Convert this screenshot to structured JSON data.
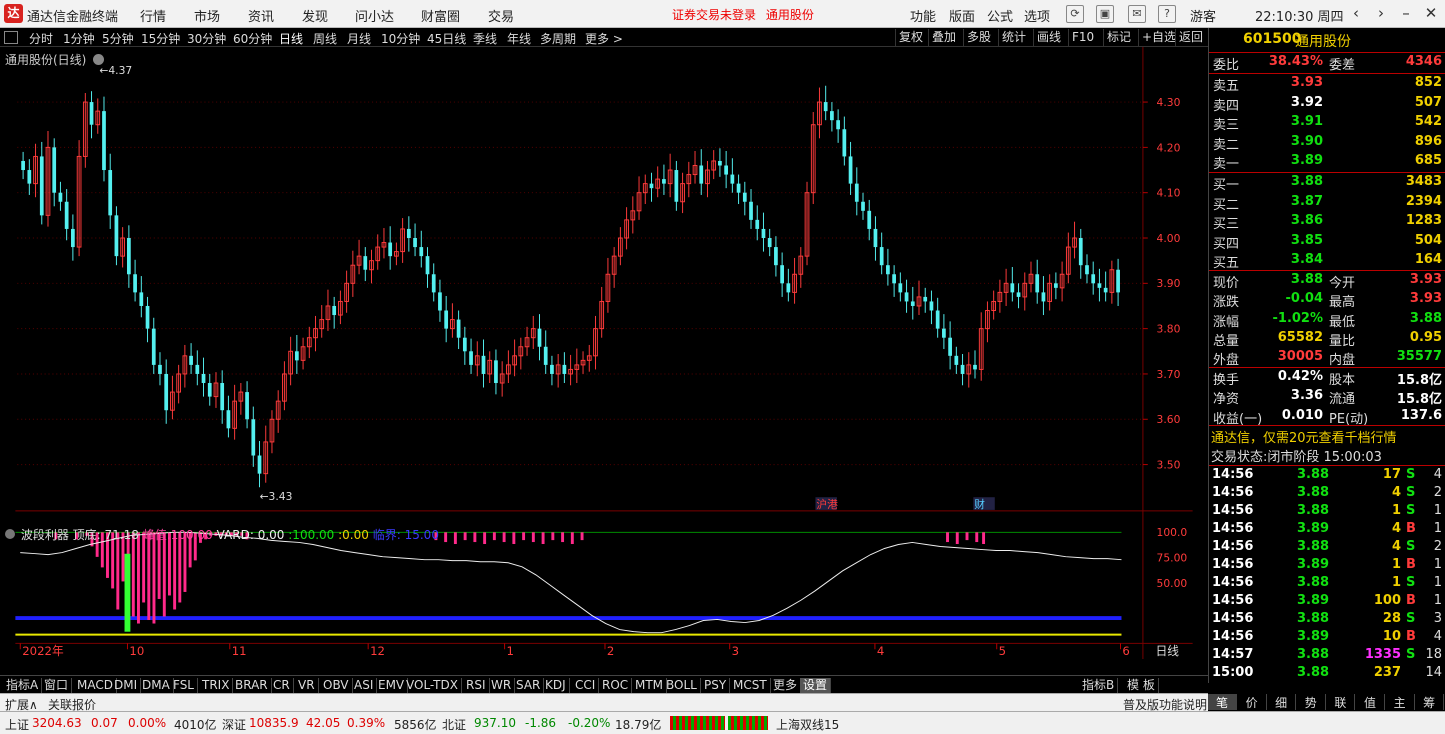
{
  "titlebar": {
    "logo": "达",
    "app_title": "通达信金融终端",
    "menu": [
      "行情",
      "市场",
      "资讯",
      "发现",
      "问小达",
      "财富圈",
      "交易"
    ],
    "notice_left": "证券交易未登录",
    "notice_right": "通用股份",
    "right_menu": [
      "功能",
      "版面",
      "公式",
      "选项"
    ],
    "user": "游客",
    "clock": "22:10:30 周四"
  },
  "period_bar": {
    "items": [
      "分时",
      "1分钟",
      "5分钟",
      "15分钟",
      "30分钟",
      "60分钟",
      "日线",
      "周线",
      "月线",
      "10分钟",
      "45日线",
      "季线",
      "年线",
      "多周期",
      "更多 >"
    ],
    "active": "日线",
    "tools": [
      "复权",
      "叠加",
      "多股",
      "统计",
      "画线",
      "F10",
      "标记",
      "+自选",
      "返回"
    ]
  },
  "chart": {
    "title": "通用股份(日线)",
    "high_label": "4.37",
    "low_label": "3.43",
    "event_marks": [
      "沪港",
      "财"
    ],
    "date_labels": [
      "2022年",
      "10",
      "11",
      "12",
      "1",
      "2",
      "3",
      "4",
      "5",
      "6"
    ],
    "period_tag": "日线",
    "indicator": {
      "name": "波段利器",
      "ding_di_label": "顶底:",
      "ding_di_value": "71.18",
      "peak_label": "峰值:",
      "peak_value": "100.00",
      "vard_label": "VARD:",
      "vard_value": "0.00",
      "sep1": ":100.00",
      "sep2": ":0.00",
      "limit_label": "临界:",
      "limit_value": "15.00"
    },
    "chart_data": {
      "type": "candlestick",
      "price_axis": [
        "4.30",
        "4.20",
        "4.10",
        "4.00",
        "3.90",
        "3.80",
        "3.70",
        "3.60",
        "3.50"
      ],
      "ylim": [
        3.4,
        4.4
      ],
      "indicator_axis": [
        "100.0",
        "75.00",
        "50.00"
      ],
      "indicator_ylim": [
        0,
        100
      ],
      "close": [
        4.15,
        4.12,
        4.18,
        4.05,
        4.2,
        4.1,
        4.08,
        4.02,
        3.98,
        4.18,
        4.3,
        4.25,
        4.28,
        4.15,
        4.05,
        3.96,
        4.0,
        3.92,
        3.88,
        3.85,
        3.8,
        3.72,
        3.7,
        3.62,
        3.66,
        3.7,
        3.74,
        3.72,
        3.7,
        3.68,
        3.65,
        3.68,
        3.62,
        3.58,
        3.64,
        3.66,
        3.6,
        3.52,
        3.48,
        3.55,
        3.6,
        3.64,
        3.7,
        3.75,
        3.73,
        3.76,
        3.78,
        3.8,
        3.82,
        3.85,
        3.83,
        3.86,
        3.9,
        3.94,
        3.96,
        3.93,
        3.95,
        3.98,
        3.99,
        3.96,
        3.97,
        4.02,
        4.0,
        3.98,
        3.96,
        3.92,
        3.88,
        3.84,
        3.8,
        3.82,
        3.78,
        3.75,
        3.72,
        3.74,
        3.7,
        3.73,
        3.68,
        3.7,
        3.72,
        3.74,
        3.76,
        3.78,
        3.8,
        3.76,
        3.72,
        3.7,
        3.72,
        3.7,
        3.71,
        3.72,
        3.73,
        3.74,
        3.8,
        3.86,
        3.92,
        3.96,
        4.0,
        4.04,
        4.06,
        4.1,
        4.12,
        4.11,
        4.13,
        4.12,
        4.15,
        4.08,
        4.12,
        4.14,
        4.16,
        4.12,
        4.15,
        4.17,
        4.16,
        4.14,
        4.12,
        4.1,
        4.08,
        4.04,
        4.02,
        4.0,
        3.98,
        3.94,
        3.9,
        3.88,
        3.92,
        3.96,
        4.1,
        4.25,
        4.3,
        4.28,
        4.26,
        4.24,
        4.18,
        4.12,
        4.08,
        4.06,
        4.02,
        3.98,
        3.94,
        3.92,
        3.9,
        3.88,
        3.86,
        3.85,
        3.87,
        3.86,
        3.84,
        3.8,
        3.78,
        3.74,
        3.72,
        3.7,
        3.72,
        3.71,
        3.8,
        3.84,
        3.86,
        3.88,
        3.9,
        3.88,
        3.87,
        3.9,
        3.92,
        3.88,
        3.86,
        3.9,
        3.89,
        3.92,
        3.98,
        4.0,
        3.94,
        3.92,
        3.9,
        3.89,
        3.88,
        3.93,
        3.88
      ],
      "indicator_line": [
        80,
        79,
        78,
        80,
        84,
        88,
        91,
        94,
        97,
        98,
        99,
        100,
        100,
        99,
        98,
        97,
        95,
        94,
        92,
        91,
        90,
        88,
        85,
        82,
        80,
        78,
        76,
        75,
        74,
        73,
        73,
        72,
        72,
        71,
        71,
        70,
        66,
        58,
        48,
        38,
        28,
        18,
        10,
        4,
        2,
        1,
        1,
        4,
        8,
        13,
        14,
        12,
        11,
        13,
        18,
        25,
        33,
        42,
        52,
        62,
        70,
        78,
        84,
        88,
        90,
        88,
        86,
        85,
        84,
        83,
        82,
        82,
        81,
        80,
        78,
        76,
        75,
        74,
        74,
        73
      ],
      "pink_bar_region_1": [
        0,
        1,
        2,
        3,
        4,
        5,
        6,
        7,
        8,
        9,
        10,
        11,
        12,
        13,
        14,
        15,
        16,
        17,
        18,
        19,
        20,
        21,
        22,
        23,
        24,
        25,
        26,
        27,
        28,
        29,
        30,
        31,
        32,
        33,
        34,
        35,
        36,
        37,
        38,
        39,
        40,
        41,
        42,
        43,
        44,
        45,
        46,
        47,
        48,
        49,
        50
      ],
      "bar_depth_1": [
        2,
        0,
        0,
        0,
        2,
        0,
        1,
        4,
        7,
        10,
        13,
        16,
        22,
        14,
        18,
        24,
        26,
        20,
        25,
        26,
        19,
        24,
        18,
        22,
        20,
        17,
        10,
        8,
        3,
        2,
        1,
        1,
        1,
        1,
        1,
        1,
        1,
        2,
        0,
        0,
        0,
        0,
        0,
        0,
        0,
        0,
        0,
        0,
        0,
        0,
        0
      ],
      "green_bar_value": 28
    }
  },
  "quote_panel": {
    "code": "601500",
    "name": "通用股份",
    "wei_bi_label": "委比",
    "wei_bi": "38.43%",
    "wei_cha_label": "委差",
    "wei_cha": "4346",
    "asks": [
      {
        "label": "卖五",
        "price": "3.93",
        "vol": "852"
      },
      {
        "label": "卖四",
        "price": "3.92",
        "vol": "507"
      },
      {
        "label": "卖三",
        "price": "3.91",
        "vol": "542"
      },
      {
        "label": "卖二",
        "price": "3.90",
        "vol": "896"
      },
      {
        "label": "卖一",
        "price": "3.89",
        "vol": "685"
      }
    ],
    "bids": [
      {
        "label": "买一",
        "price": "3.88",
        "vol": "3483"
      },
      {
        "label": "买二",
        "price": "3.87",
        "vol": "2394"
      },
      {
        "label": "买三",
        "price": "3.86",
        "vol": "1283"
      },
      {
        "label": "买四",
        "price": "3.85",
        "vol": "504"
      },
      {
        "label": "买五",
        "price": "3.84",
        "vol": "164"
      }
    ],
    "stats": [
      {
        "l1": "现价",
        "v1": "3.88",
        "c1": "grn",
        "l2": "今开",
        "v2": "3.93",
        "c2": "red"
      },
      {
        "l1": "涨跌",
        "v1": "-0.04",
        "c1": "grn",
        "l2": "最高",
        "v2": "3.93",
        "c2": "red"
      },
      {
        "l1": "涨幅",
        "v1": "-1.02%",
        "c1": "grn",
        "l2": "最低",
        "v2": "3.88",
        "c2": "grn"
      },
      {
        "l1": "总量",
        "v1": "65582",
        "c1": "yel",
        "l2": "量比",
        "v2": "0.95",
        "c2": "yel"
      },
      {
        "l1": "外盘",
        "v1": "30005",
        "c1": "red",
        "l2": "内盘",
        "v2": "35577",
        "c2": "grn"
      }
    ],
    "stats2": [
      {
        "l1": "换手",
        "v1": "0.42%",
        "l2": "股本",
        "v2": "15.8亿"
      },
      {
        "l1": "净资",
        "v1": "3.36",
        "l2": "流通",
        "v2": "15.8亿"
      },
      {
        "l1": "收益(一)",
        "v1": "0.010",
        "l2": "PE(动)",
        "v2": "137.6"
      }
    ],
    "promo": "通达信，仅需20元查看千档行情",
    "trade_status": "交易状态:闭市阶段 15:00:03",
    "ticks": [
      {
        "time": "14:56",
        "price": "3.88",
        "pc": "grn",
        "vol": "17",
        "side": "S"
      },
      {
        "time": "14:56",
        "price": "3.88",
        "pc": "grn",
        "vol": "4",
        "side": "S"
      },
      {
        "time": "14:56",
        "price": "3.88",
        "pc": "grn",
        "vol": "1",
        "side": "S"
      },
      {
        "time": "14:56",
        "price": "3.89",
        "pc": "grn",
        "vol": "4",
        "side": "B"
      },
      {
        "time": "14:56",
        "price": "3.88",
        "pc": "grn",
        "vol": "4",
        "side": "S"
      },
      {
        "time": "14:56",
        "price": "3.89",
        "pc": "grn",
        "vol": "1",
        "side": "B"
      },
      {
        "time": "14:56",
        "price": "3.88",
        "pc": "grn",
        "vol": "1",
        "side": "S"
      },
      {
        "time": "14:56",
        "price": "3.89",
        "pc": "grn",
        "vol": "100",
        "side": "B"
      },
      {
        "time": "14:56",
        "price": "3.88",
        "pc": "grn",
        "vol": "28",
        "side": "S"
      },
      {
        "time": "14:56",
        "price": "3.89",
        "pc": "grn",
        "vol": "10",
        "side": "B"
      },
      {
        "time": "14:57",
        "price": "3.88",
        "pc": "grn",
        "vol": "1335",
        "side": "S"
      },
      {
        "time": "15:00",
        "price": "3.88",
        "pc": "grn",
        "vol": "237",
        "side": ""
      }
    ],
    "tick_counts": [
      "4",
      "2",
      "1",
      "1",
      "2",
      "1",
      "1",
      "1",
      "3",
      "4",
      "18",
      "14"
    ]
  },
  "bottom_tabs": {
    "items": [
      "指标A",
      "窗口",
      "MACD",
      "DMI",
      "DMA",
      "FSL",
      "TRIX",
      "BRAR",
      "CR",
      "VR",
      "OBV",
      "ASI",
      "EMV",
      "VOL-TDX",
      "RSI",
      "WR",
      "SAR",
      "KDJ",
      "CCI",
      "ROC",
      "MTM",
      "BOLL",
      "PSY",
      "MCST",
      "更多",
      "设置"
    ],
    "selected": "设置",
    "right": [
      "指标B",
      "模 板"
    ]
  },
  "ext_bar": {
    "left1": "扩展∧",
    "left2": "关联报价",
    "right": "普及版功能说明"
  },
  "right_tabs": [
    "笔",
    "价",
    "细",
    "势",
    "联",
    "值",
    "主",
    "筹"
  ],
  "status_bar": {
    "sh_label": "上证",
    "sh_val": "3204.63",
    "sh_chg": "0.07",
    "sh_pct": "0.00%",
    "sh_amt": "4010亿",
    "sz_label": "深证",
    "sz_val": "10835.9",
    "sz_chg": "42.05",
    "sz_pct": "0.39%",
    "sz_amt": "5856亿",
    "bz_label": "北证",
    "bz_val": "937.10",
    "bz_chg": "-1.86",
    "bz_pct": "-0.20%",
    "bz_amt": "18.79亿",
    "ticker": "上海双线15"
  },
  "colors": {
    "up": "#ff3b3b",
    "down": "#54f0f0",
    "bg": "#000000",
    "grid": "#7a0000"
  }
}
